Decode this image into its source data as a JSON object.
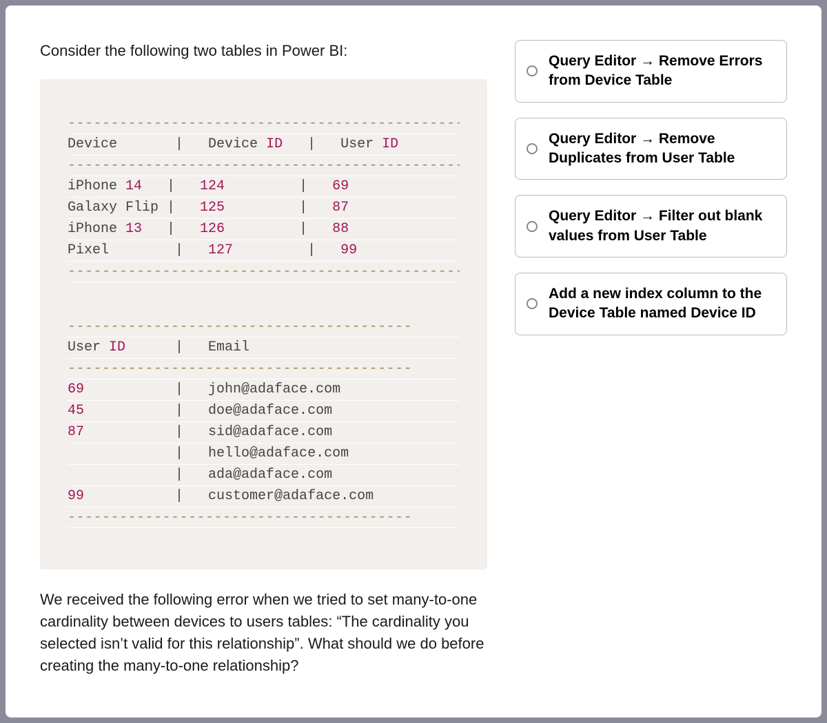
{
  "question": {
    "intro": "Consider the following two tables in Power BI:",
    "outro": "We received the following error when we tried to set many-to-one cardinality between devices to users tables: “The cardinality you selected isn’t valid for this relationship”. What should we do before creating the many-to-one relationship?"
  },
  "code": {
    "table1": {
      "dash": "------------------------------------------------",
      "header_span1": "Device       ",
      "header_span2": "|   Device ",
      "header_span3": "ID   ",
      "header_span4": "|   User ",
      "header_span5": "ID",
      "rows": [
        {
          "c1": "iPhone ",
          "c2": "14   ",
          "c3": "|   ",
          "c4": "124         ",
          "c5": "|   ",
          "c6": "69"
        },
        {
          "c1": "Galaxy Flip ",
          "c2": "",
          "c3": "|   ",
          "c4": "125         ",
          "c5": "|   ",
          "c6": "87"
        },
        {
          "c1": "iPhone ",
          "c2": "13   ",
          "c3": "|   ",
          "c4": "126         ",
          "c5": "|   ",
          "c6": "88"
        },
        {
          "c1": "Pixel        ",
          "c2": "",
          "c3": "|   ",
          "c4": "127         ",
          "c5": "|   ",
          "c6": "99"
        }
      ]
    },
    "table2": {
      "dash": "----------------------------------------",
      "header_span1": "User ",
      "header_span2": "ID      ",
      "header_span3": "|   Email",
      "rows": [
        {
          "c1": "69           ",
          "c2": "|   john@adaface.com"
        },
        {
          "c1": "45           ",
          "c2": "|   doe@adaface.com"
        },
        {
          "c1": "87           ",
          "c2": "|   sid@adaface.com"
        },
        {
          "c1": "             ",
          "c2": "|   hello@adaface.com"
        },
        {
          "c1": "             ",
          "c2": "|   ada@adaface.com"
        },
        {
          "c1": "99           ",
          "c2": "|   customer@adaface.com"
        }
      ]
    }
  },
  "options": [
    {
      "label": "Query Editor → Remove Errors from Device Table"
    },
    {
      "label": "Query Editor → Remove Duplicates from User Table"
    },
    {
      "label": "Query Editor → Filter out blank values from User Table"
    },
    {
      "label": "Add a new index column to the Device Table named Device ID"
    }
  ]
}
